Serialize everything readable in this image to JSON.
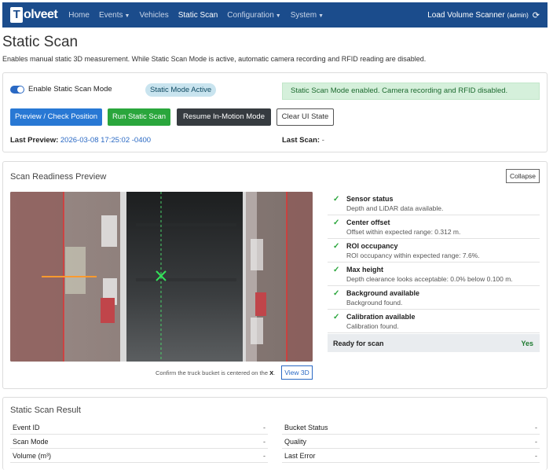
{
  "navbar": {
    "logo_letter": "T",
    "logo_rest": "olveet",
    "items": [
      {
        "label": "Home",
        "dropdown": false
      },
      {
        "label": "Events",
        "dropdown": true
      },
      {
        "label": "Vehicles",
        "dropdown": false
      },
      {
        "label": "Static Scan",
        "dropdown": false,
        "active": true
      },
      {
        "label": "Configuration",
        "dropdown": true
      },
      {
        "label": "System",
        "dropdown": true
      }
    ],
    "app_name": "Load Volume Scanner",
    "user": "(admin)",
    "refresh_icon": "refresh-icon",
    "background": "#1b4c8c"
  },
  "page": {
    "title": "Static Scan",
    "description": "Enables manual static 3D measurement. While Static Scan Mode is active, automatic camera recording and RFID reading are disabled."
  },
  "controls": {
    "toggle_label": "Enable Static Scan Mode",
    "toggle_on": true,
    "status_pill": "Static Mode Active",
    "alert": "Static Scan Mode enabled. Camera recording and RFID disabled.",
    "buttons": {
      "preview": "Preview / Check Position",
      "run": "Run Static Scan",
      "resume": "Resume In-Motion Mode",
      "clear": "Clear UI State"
    },
    "last_preview_label": "Last Preview:",
    "last_preview_value": "2026-03-08 17:25:02 -0400",
    "last_scan_label": "Last Scan:",
    "last_scan_value": "-"
  },
  "readiness": {
    "title": "Scan Readiness Preview",
    "collapse_label": "Collapse",
    "caption_prefix": "Confirm the truck bucket is centered on the",
    "caption_marker": "X",
    "caption_suffix": ".",
    "view3d_label": "View 3D",
    "checks": [
      {
        "title": "Sensor status",
        "detail": "Depth and LiDAR data available.",
        "mark": "✓"
      },
      {
        "title": "Center offset",
        "detail": "Offset within expected range: 0.312 m.",
        "mark": "✓"
      },
      {
        "title": "ROI occupancy",
        "detail": "ROI occupancy within expected range: 7.6%.",
        "mark": "✓"
      },
      {
        "title": "Max height",
        "detail": "Depth clearance looks acceptable: 0.0% below 0.100 m.",
        "mark": "✓"
      },
      {
        "title": "Background available",
        "detail": "Background found.",
        "mark": "✓"
      },
      {
        "title": "Calibration available",
        "detail": "Calibration found.",
        "mark": "✓"
      }
    ],
    "ready_label": "Ready for scan",
    "ready_value": "Yes",
    "status_color": "#2aa63c"
  },
  "result": {
    "title": "Static Scan Result",
    "left": [
      {
        "key": "Event ID",
        "value": "-"
      },
      {
        "key": "Scan Mode",
        "value": "-"
      },
      {
        "key": "Volume (m³)",
        "value": "-"
      }
    ],
    "right": [
      {
        "key": "Bucket Status",
        "value": "-"
      },
      {
        "key": "Quality",
        "value": "-"
      },
      {
        "key": "Last Error",
        "value": "-"
      }
    ]
  }
}
